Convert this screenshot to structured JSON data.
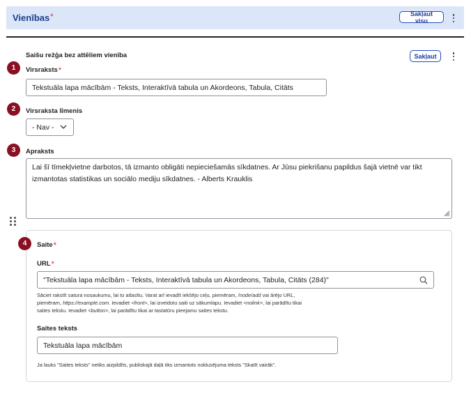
{
  "header": {
    "title": "Vienības",
    "required_mark": "*",
    "collapse_all": "Sakļaut visu"
  },
  "section": {
    "title": "Saišu režģa bez attēliem vienība",
    "collapse": "Sakļaut"
  },
  "badges": [
    "1",
    "2",
    "3",
    "4"
  ],
  "heading_field": {
    "label": "Virsraksts",
    "required_mark": "*",
    "value": "Tekstuāla lapa mācībām - Teksts, Interaktīvā tabula un Akordeons, Tabula, Citāts"
  },
  "heading_level": {
    "label": "Virsraksta līmenis",
    "selected": "- Nav -"
  },
  "description": {
    "label": "Apraksts",
    "value": "Lai šī tīmekļvietne darbotos, tā izmanto obligāti nepieciešamās sīkdatnes. Ar Jūsu piekrišanu papildus šajā vietnē var tikt izmantotas statistikas un sociālo mediju sīkdatnes. - Alberts Krauklis"
  },
  "link": {
    "label": "Saite",
    "required_mark": "*",
    "url_label": "URL",
    "url_value": "\"Tekstuāla lapa mācībām - Teksts, Interaktīvā tabula un Akordeons, Tabula, Citāts (284)\"",
    "help": {
      "t1": "Sāciet rakstīt satura nosaukumu, lai to atlasītu. Varat arī ievadīt iekšējo ceļu, piemēram, ",
      "e1": "/node/add",
      "t2": " vai ārējo URL, piemēram, ",
      "e2": "https://example.com",
      "t3": ". Ievadiet ",
      "e3": "<front>",
      "t4": ", lai izveidotu saiti uz sākumlapu. Ievadiet ",
      "e4": "<nolink>",
      "t5": ", lai parādītu tikai saites tekstu. Ievadiet ",
      "e5": "<button>",
      "t6": ", lai parādītu tikai ar tastatūru pieejamu saites tekstu."
    },
    "text_label": "Saites teksts",
    "text_value": "Tekstuāla lapa mācībām",
    "text_help": "Ja lauks \"Saites teksts\" netiks aizpildīts, publiskajā daļā tiks izmantots noklusējuma teksts \"Skatīt vairāk\"."
  },
  "colors": {
    "header_bg": "#dbe6f8",
    "title_blue": "#1b3d8f",
    "button_border": "#1e4bc6",
    "badge": "#8a0f22",
    "required": "#d72222"
  },
  "icons": [
    "kebab-menu-icon",
    "chevron-down-icon",
    "resize-handle-icon",
    "drag-handle-icon",
    "search-icon"
  ]
}
